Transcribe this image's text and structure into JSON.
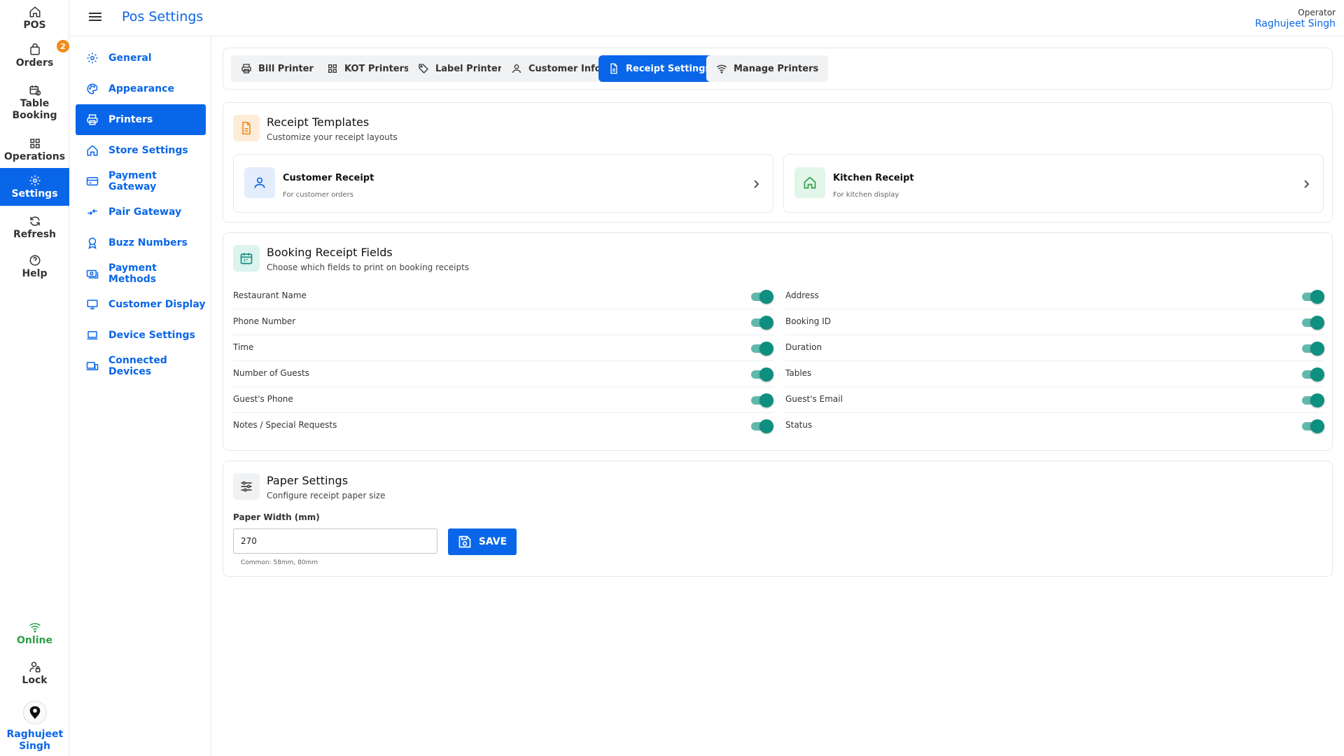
{
  "rail": {
    "items": [
      {
        "label": "POS",
        "icon": "home-icon"
      },
      {
        "label": "Orders",
        "icon": "bag-icon",
        "badge": "2"
      },
      {
        "label": "Table Booking",
        "icon": "calendar-clock-icon"
      },
      {
        "label": "Operations",
        "icon": "grid-icon"
      },
      {
        "label": "Settings",
        "icon": "gear-icon",
        "active": true
      },
      {
        "label": "Refresh",
        "icon": "refresh-icon"
      },
      {
        "label": "Help",
        "icon": "help-icon"
      }
    ],
    "status": "Online",
    "lock": "Lock",
    "user": "Raghujeet Singh"
  },
  "header": {
    "title": "Pos Settings",
    "operator_role": "Operator",
    "operator_name": "Raghujeet Singh"
  },
  "settings_nav": [
    {
      "label": "General",
      "icon": "gear-icon"
    },
    {
      "label": "Appearance",
      "icon": "palette-icon"
    },
    {
      "label": "Printers",
      "icon": "printer-icon",
      "active": true
    },
    {
      "label": "Store Settings",
      "icon": "home-icon"
    },
    {
      "label": "Payment Gateway",
      "icon": "card-icon"
    },
    {
      "label": "Pair Gateway",
      "icon": "arrows-icon"
    },
    {
      "label": "Buzz Numbers",
      "icon": "badge-icon"
    },
    {
      "label": "Payment Methods",
      "icon": "cash-icon"
    },
    {
      "label": "Customer Display",
      "icon": "monitor-icon"
    },
    {
      "label": "Device Settings",
      "icon": "laptop-icon"
    },
    {
      "label": "Connected Devices",
      "icon": "devices-icon"
    }
  ],
  "tabs": [
    {
      "label": "Bill Printer",
      "icon": "printer-icon"
    },
    {
      "label": "KOT Printers",
      "icon": "grid-icon"
    },
    {
      "label": "Label Printer",
      "icon": "tag-icon"
    },
    {
      "label": "Customer Info",
      "icon": "user-icon"
    },
    {
      "label": "Receipt Settings",
      "icon": "document-icon",
      "active": true
    },
    {
      "label": "Manage Printers",
      "icon": "wifi-icon"
    }
  ],
  "receipt_templates": {
    "title": "Receipt Templates",
    "subtitle": "Customize your receipt layouts",
    "items": [
      {
        "title": "Customer Receipt",
        "subtitle": "For customer orders",
        "icon": "user-icon"
      },
      {
        "title": "Kitchen Receipt",
        "subtitle": "For kitchen display",
        "icon": "home-icon"
      }
    ]
  },
  "booking_fields": {
    "title": "Booking Receipt Fields",
    "subtitle": "Choose which fields to print on booking receipts",
    "left": [
      {
        "label": "Restaurant Name",
        "enabled": true
      },
      {
        "label": "Phone Number",
        "enabled": true
      },
      {
        "label": "Time",
        "enabled": true
      },
      {
        "label": "Number of Guests",
        "enabled": true
      },
      {
        "label": "Guest's Phone",
        "enabled": true
      },
      {
        "label": "Notes / Special Requests",
        "enabled": true
      }
    ],
    "right": [
      {
        "label": "Address",
        "enabled": true
      },
      {
        "label": "Booking ID",
        "enabled": true
      },
      {
        "label": "Duration",
        "enabled": true
      },
      {
        "label": "Tables",
        "enabled": true
      },
      {
        "label": "Guest's Email",
        "enabled": true
      },
      {
        "label": "Status",
        "enabled": true
      }
    ]
  },
  "paper_settings": {
    "title": "Paper Settings",
    "subtitle": "Configure receipt paper size",
    "width_label": "Paper Width (mm)",
    "width_value": "270",
    "save_label": "SAVE",
    "hint": "Common: 58mm, 80mm"
  },
  "colors": {
    "accent": "#0a66e8",
    "toggle_on": "#0e8f7f",
    "online": "#2e9e4a",
    "badge": "#f28c1b"
  }
}
